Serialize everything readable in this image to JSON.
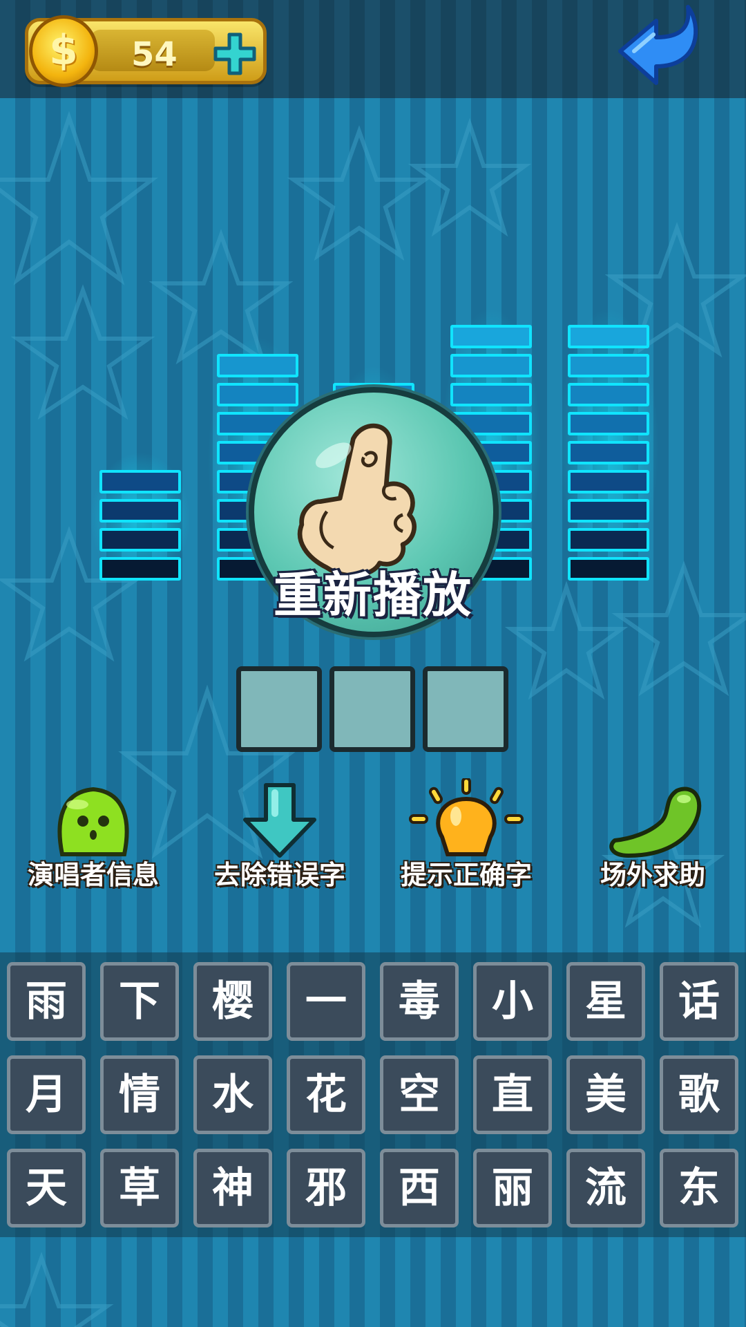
{
  "coins": {
    "count": "54"
  },
  "replay": {
    "label": "重新播放"
  },
  "equalizer_levels": [
    4,
    8,
    7,
    9,
    9
  ],
  "answer_slots": [
    "",
    "",
    ""
  ],
  "tools": [
    {
      "id": "singer-info",
      "label": "演唱者信息",
      "icon": "green-monster-icon"
    },
    {
      "id": "remove-wrong",
      "label": "去除错误字",
      "icon": "down-arrow-icon"
    },
    {
      "id": "hint-correct",
      "label": "提示正确字",
      "icon": "lightbulb-icon"
    },
    {
      "id": "call-help",
      "label": "场外求助",
      "icon": "phone-icon"
    }
  ],
  "letters": [
    [
      "雨",
      "下",
      "樱",
      "一",
      "毒",
      "小",
      "星",
      "话"
    ],
    [
      "月",
      "情",
      "水",
      "花",
      "空",
      "直",
      "美",
      "歌"
    ],
    [
      "天",
      "草",
      "神",
      "邪",
      "西",
      "丽",
      "流",
      "东"
    ]
  ],
  "colors": {
    "eq_segment": "#10e4ff",
    "key_bg": "#3b4b5b",
    "slot_bg": "#80b7b9"
  }
}
